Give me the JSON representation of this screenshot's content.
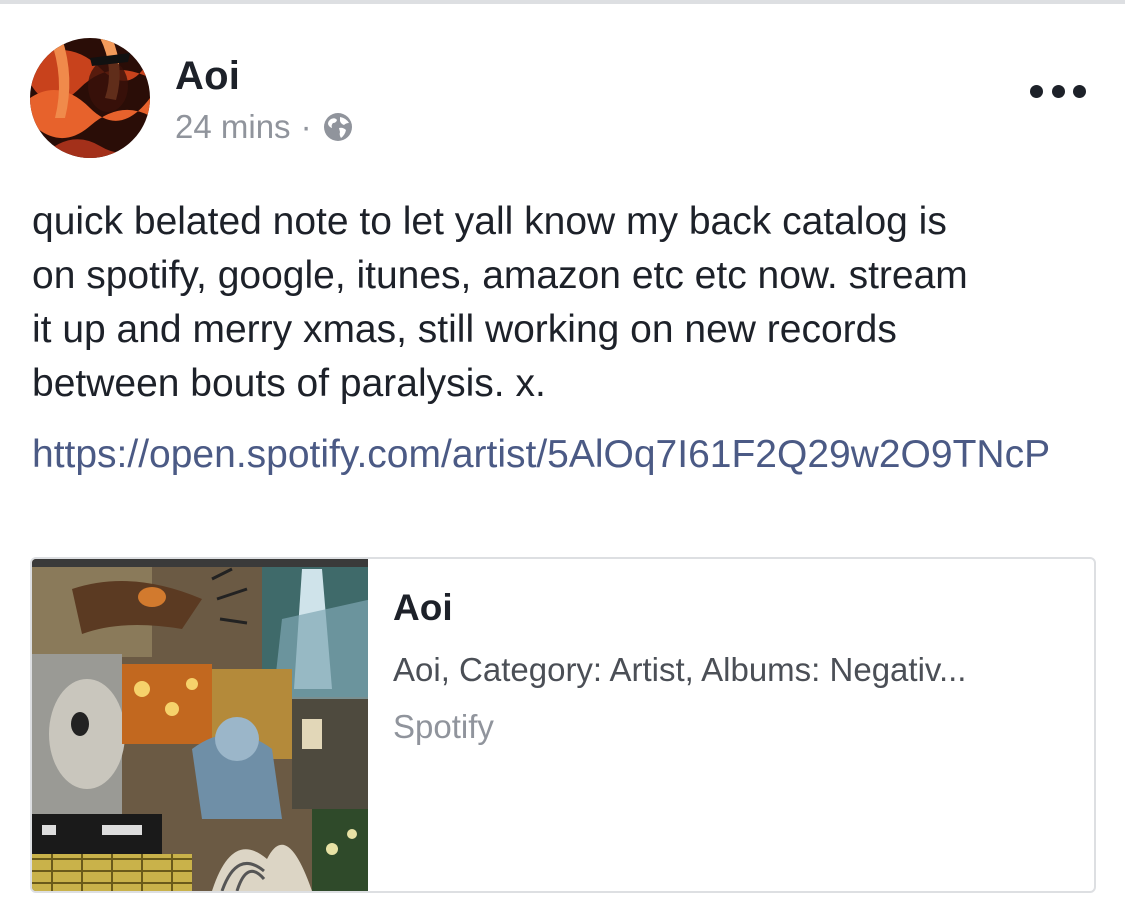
{
  "post": {
    "author": "Aoi",
    "time": "24 mins",
    "separator": "·",
    "privacy_icon": "globe-icon",
    "more_icon": "more-horizontal-icon",
    "text": "quick belated note to let yall know my back catalog is\non spotify, google, itunes, amazon etc etc now. stream\nit up and merry xmas, still working on new records\nbetween bouts of paralysis. x.",
    "link": "https://open.spotify.com/artist/5AlOq7I61F2Q29w2O9TNcP"
  },
  "link_preview": {
    "title": "Aoi",
    "description": "Aoi, Category: Artist, Albums: Negativ...",
    "source": "Spotify",
    "image": "album-collage-image"
  },
  "colors": {
    "text": "#1d2129",
    "meta": "#90949c",
    "link": "#4b5a85",
    "card_border": "#dddfe2"
  }
}
